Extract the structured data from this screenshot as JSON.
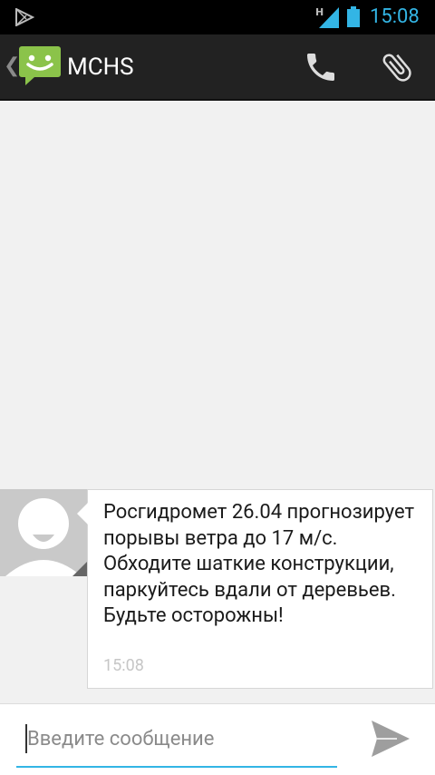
{
  "status_bar": {
    "network_type": "H",
    "time": "15:08",
    "icons": [
      "play-store-icon",
      "signal-icon",
      "battery-icon"
    ],
    "accent_color": "#33b5e5"
  },
  "action_bar": {
    "title": "MCHS",
    "icons": [
      "back-chevron-icon",
      "messaging-app-icon",
      "phone-icon",
      "attachment-icon"
    ]
  },
  "thread": {
    "messages": [
      {
        "text": "Росгидромет 26.04 прогнозирует порывы ветра до 17 м/с. Обходите шаткие конструкции, паркуйтесь вдали от деревьев. Будьте осторожны!",
        "time": "15:08",
        "avatar_icon": "default-contact-avatar-icon"
      }
    ]
  },
  "composer": {
    "placeholder": "Введите сообщение",
    "value": "",
    "send_icon": "send-icon"
  }
}
